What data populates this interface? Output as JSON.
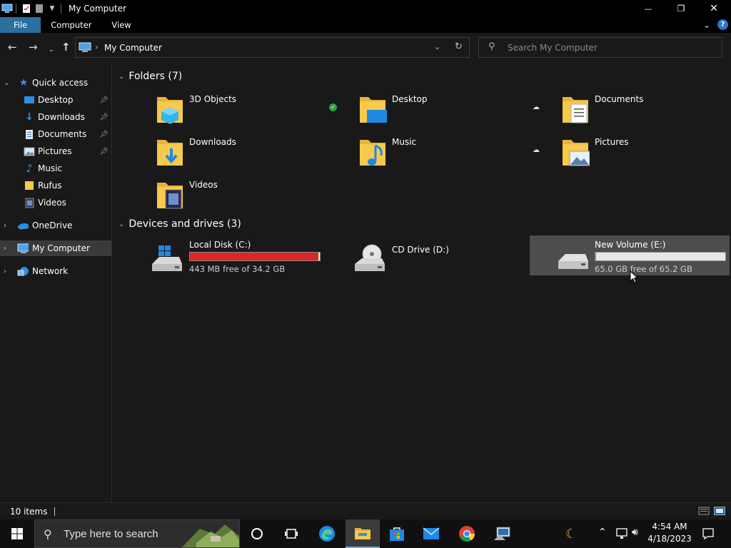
{
  "window": {
    "title": "My Computer",
    "minimize_glyph": "—",
    "maximize_glyph": "❐",
    "close_glyph": "✕"
  },
  "ribbon": {
    "tabs": [
      "File",
      "Computer",
      "View"
    ],
    "help_glyph": "?"
  },
  "address": {
    "path_root_sep": "›",
    "location": "My Computer"
  },
  "search": {
    "placeholder": "Search My Computer"
  },
  "navpane": {
    "quick_access": "Quick access",
    "items": [
      {
        "label": "Desktop",
        "pinned": true,
        "icon": "desktop-icon"
      },
      {
        "label": "Downloads",
        "pinned": true,
        "icon": "download-icon"
      },
      {
        "label": "Documents",
        "pinned": true,
        "icon": "documents-icon"
      },
      {
        "label": "Pictures",
        "pinned": true,
        "icon": "pictures-icon"
      },
      {
        "label": "Music",
        "pinned": false,
        "icon": "music-icon"
      },
      {
        "label": "Rufus",
        "pinned": false,
        "icon": "folder-icon"
      },
      {
        "label": "Videos",
        "pinned": false,
        "icon": "videos-icon"
      }
    ],
    "onedrive": "OneDrive",
    "my_computer": "My Computer",
    "network": "Network"
  },
  "folders": {
    "heading": "Folders (7)",
    "items": [
      {
        "label": "3D Objects",
        "icon": "3d-objects-icon"
      },
      {
        "label": "Desktop",
        "icon": "desktop-folder-icon",
        "status": "synced"
      },
      {
        "label": "Documents",
        "icon": "documents-folder-icon",
        "status": "cloud"
      },
      {
        "label": "Downloads",
        "icon": "downloads-folder-icon"
      },
      {
        "label": "Music",
        "icon": "music-folder-icon"
      },
      {
        "label": "Pictures",
        "icon": "pictures-folder-icon",
        "status": "cloud"
      },
      {
        "label": "Videos",
        "icon": "videos-folder-icon"
      }
    ]
  },
  "drives": {
    "heading": "Devices and drives (3)",
    "items": [
      {
        "label": "Local Disk (C:)",
        "free_text": "443 MB free of 34.2 GB",
        "used_fraction": 0.987,
        "bar_color": "#da2626",
        "icon": "windows-drive-icon"
      },
      {
        "label": "CD Drive (D:)",
        "free_text": "",
        "used_fraction": null,
        "icon": "cd-drive-icon"
      },
      {
        "label": "New Volume (E:)",
        "free_text": "65.0 GB free of 65.2 GB",
        "used_fraction": 0.003,
        "bar_color": "#26a0da",
        "icon": "hard-drive-icon"
      }
    ]
  },
  "status": {
    "item_count": "10 items"
  },
  "taskbar": {
    "search_placeholder": "Type here to search",
    "time": "4:54 AM",
    "date": "4/18/2023"
  },
  "colors": {
    "accent": "#2b6f9e",
    "folder_yellow": "#f7c94c",
    "drive_critical": "#da2626"
  }
}
